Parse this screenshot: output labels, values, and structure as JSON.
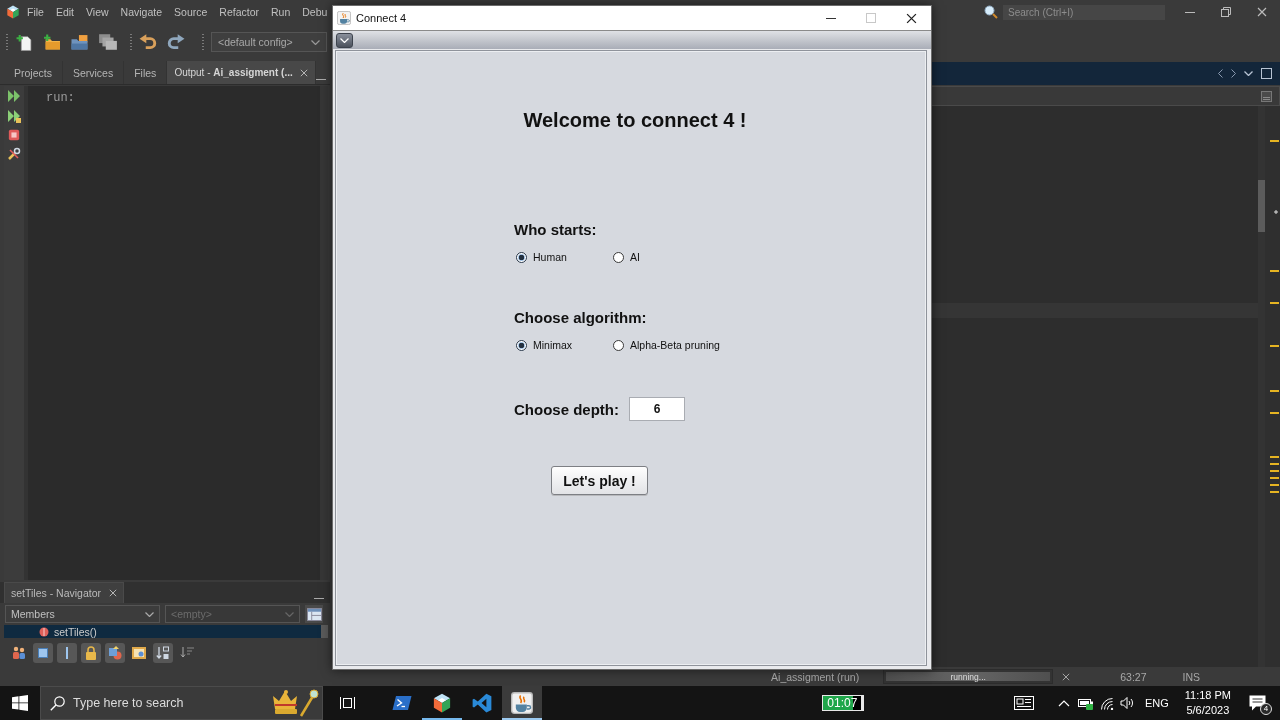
{
  "ide": {
    "menu": [
      "File",
      "Edit",
      "View",
      "Navigate",
      "Source",
      "Refactor",
      "Run",
      "Debu"
    ],
    "toolbar": {
      "config": "<default config>"
    },
    "search": {
      "placeholder": "Search (Ctrl+I)"
    },
    "output_panel": {
      "tabs": [
        {
          "label": "Projects",
          "selected": false
        },
        {
          "label": "Services",
          "selected": false
        },
        {
          "label": "Files",
          "selected": false
        },
        {
          "label": "Output - **Ai_assigment (...**",
          "selected": true
        }
      ],
      "console": [
        "run:"
      ]
    },
    "navigator": {
      "title": "setTiles - Navigator",
      "filters": [
        {
          "value": "Members",
          "disabled": false
        },
        {
          "value": "<empty>",
          "disabled": true
        }
      ],
      "members": [
        {
          "label": "setTiles()",
          "selected": true
        }
      ],
      "toolbar": [
        {
          "kind": "people",
          "on": false
        },
        {
          "kind": "square",
          "on": true
        },
        {
          "kind": "bar",
          "on": true
        },
        {
          "kind": "lock",
          "on": true
        },
        {
          "kind": "shapes",
          "on": true
        },
        {
          "kind": "frame",
          "on": false
        },
        {
          "kind": "sort",
          "on": true
        },
        {
          "kind": "lines",
          "on": false
        }
      ]
    },
    "status_bar": {
      "task": "Ai_assigment (run)",
      "progress": {
        "text": "running...",
        "level": 1
      },
      "position": "63:27",
      "mode": "INS"
    }
  },
  "dialog": {
    "title": "Connect 4",
    "heading": "Welcome to connect 4 !",
    "groups": [
      {
        "label": "Who starts:",
        "options": [
          {
            "label": "Human",
            "selected": true
          },
          {
            "label": "AI",
            "selected": false
          }
        ]
      },
      {
        "label": "Choose algorithm:",
        "options": [
          {
            "label": "Minimax",
            "selected": true
          },
          {
            "label": "Alpha-Beta pruning",
            "selected": false
          }
        ]
      }
    ],
    "depth": {
      "label": "Choose depth:",
      "value": "6"
    },
    "button": "Let's play !"
  },
  "taskbar": {
    "search": {
      "placeholder": "Type here to search"
    },
    "apps": [
      {
        "kind": "terminal",
        "running": false,
        "selected": false
      },
      {
        "kind": "ide",
        "running": true,
        "selected": false
      },
      {
        "kind": "editor",
        "running": false,
        "selected": false
      },
      {
        "kind": "java",
        "running": true,
        "selected": true
      }
    ],
    "timer": {
      "text": "01:07",
      "level": 0.78
    },
    "language": "ENG",
    "time": "11:18 PM",
    "date": "5/6/2023",
    "notifications": "4"
  }
}
